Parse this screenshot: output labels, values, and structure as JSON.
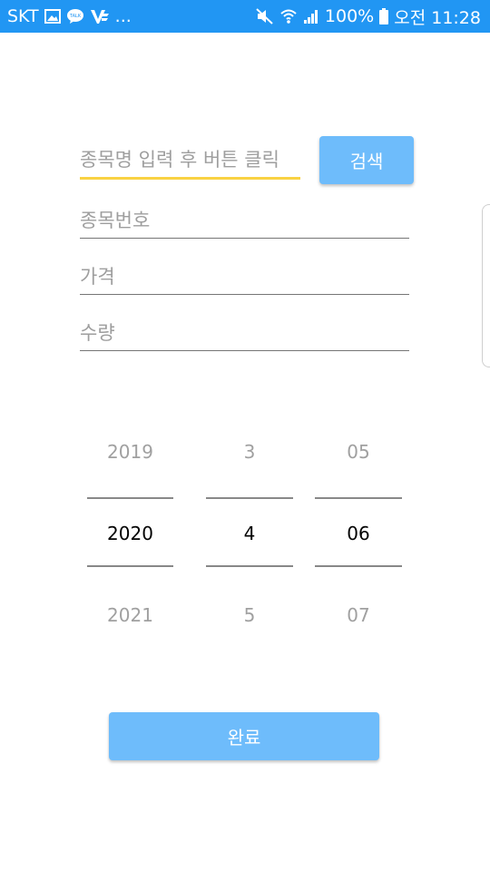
{
  "status_bar": {
    "carrier": "SKT",
    "more": "...",
    "battery": "100%",
    "time": "오전 11:28",
    "background_color": "#2196f3"
  },
  "form": {
    "search_placeholder": "종목명 입력 후 버튼 클릭",
    "search_button": "검색",
    "number_placeholder": "종목번호",
    "price_placeholder": "가격",
    "quantity_placeholder": "수량",
    "accent_color": "#f9d243",
    "button_color": "#6ebcfb"
  },
  "date_picker": {
    "year": {
      "prev": "2019",
      "current": "2020",
      "next": "2021"
    },
    "month": {
      "prev": "3",
      "current": "4",
      "next": "5"
    },
    "day": {
      "prev": "05",
      "current": "06",
      "next": "07"
    }
  },
  "done_button": "완료"
}
